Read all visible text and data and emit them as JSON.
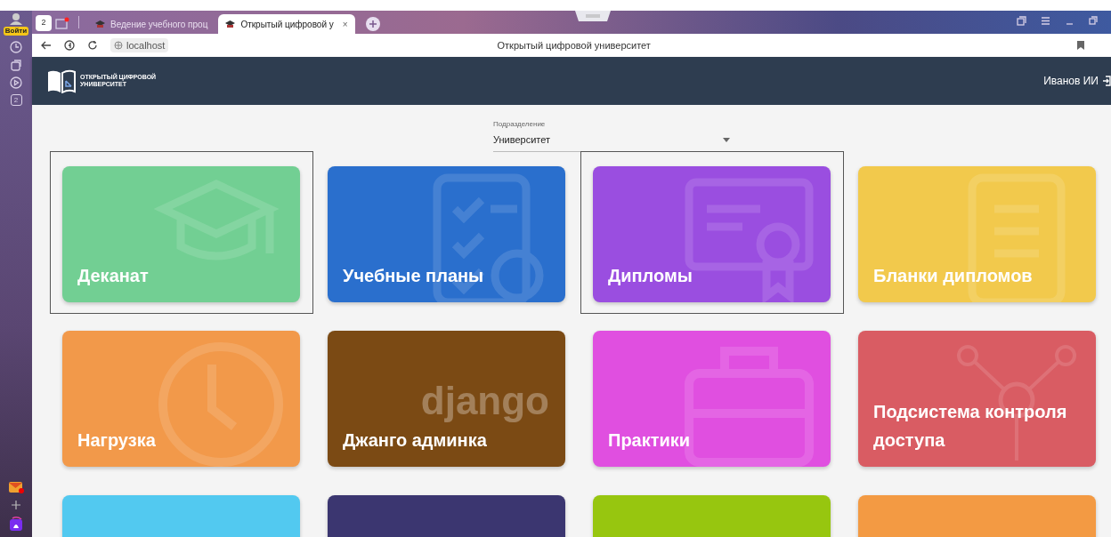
{
  "browser": {
    "login_label": "Войти",
    "tab_counter": "2",
    "tabs": [
      {
        "label": "Ведение учебного проц",
        "selected": false
      },
      {
        "label": "Открытый цифровой у",
        "selected": true
      }
    ],
    "close_label": "×",
    "address": "localhost",
    "page_title": "Открытый цифровой университет",
    "sidebar_counter": "2"
  },
  "header": {
    "logo_lines": [
      "ОТКРЫТЫЙ ЦИФРОВОЙ",
      "УНИВЕРСИТЕТ"
    ],
    "user": "Иванов ИИ"
  },
  "division": {
    "label": "Подразделение",
    "value": "Университет"
  },
  "modules": [
    {
      "title": "Деканат",
      "color": "#72cf93",
      "framed": true
    },
    {
      "title": "Учебные планы",
      "color": "#2a6fcd",
      "framed": false
    },
    {
      "title": "Дипломы",
      "color": "#9a4ee0",
      "framed": true
    },
    {
      "title": "Бланки дипломов",
      "color": "#f2c94c",
      "framed": false
    },
    {
      "title": "Нагрузка",
      "color": "#f2994a",
      "framed": false
    },
    {
      "title": "Джанго админка",
      "color": "#7b4a14",
      "framed": false,
      "background_text": "django"
    },
    {
      "title": "Практики",
      "color": "#e04fe0",
      "framed": false
    },
    {
      "title": "Подсистема контроля доступа",
      "color": "#d95c63",
      "framed": false
    },
    {
      "color": "#52c9f0",
      "framed": false
    },
    {
      "color": "#3b3670",
      "framed": false
    },
    {
      "color": "#97c60f",
      "framed": false
    },
    {
      "color": "#f39a43",
      "framed": false
    }
  ]
}
